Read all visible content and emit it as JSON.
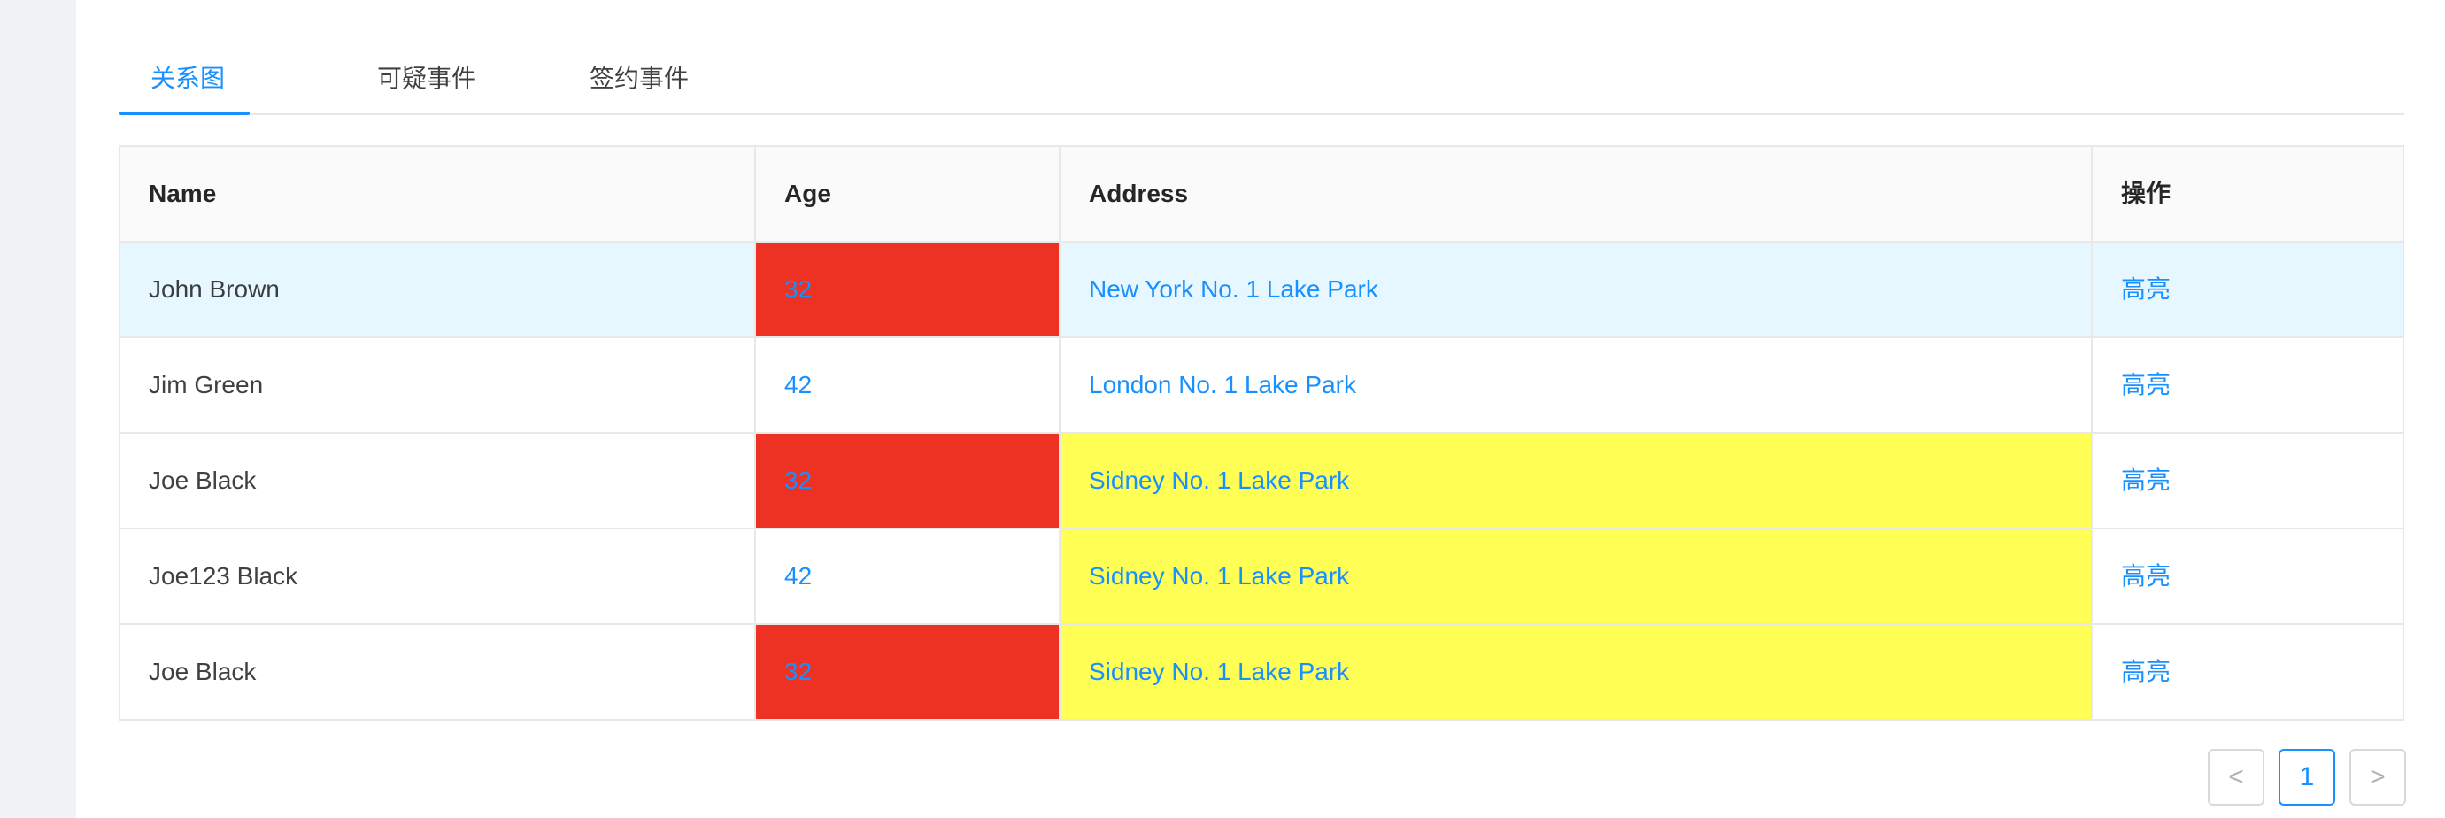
{
  "tabs": [
    {
      "label": "关系图",
      "active": true
    },
    {
      "label": "可疑事件",
      "active": false
    },
    {
      "label": "签约事件",
      "active": false
    }
  ],
  "table": {
    "columns": [
      "Name",
      "Age",
      "Address",
      "操作"
    ],
    "rows": [
      {
        "name": "John Brown",
        "age": "32",
        "address": "New York No. 1 Lake Park",
        "action": "高亮",
        "age_bg": "#ed3123",
        "address_bg": null,
        "selected": true
      },
      {
        "name": "Jim Green",
        "age": "42",
        "address": "London No. 1 Lake Park",
        "action": "高亮",
        "age_bg": null,
        "address_bg": null,
        "selected": false
      },
      {
        "name": "Joe Black",
        "age": "32",
        "address": "Sidney No. 1 Lake Park",
        "action": "高亮",
        "age_bg": "#ed3123",
        "address_bg": "#ffff55",
        "selected": false
      },
      {
        "name": "Joe123 Black",
        "age": "42",
        "address": "Sidney No. 1 Lake Park",
        "action": "高亮",
        "age_bg": null,
        "address_bg": "#ffff55",
        "selected": false
      },
      {
        "name": "Joe Black",
        "age": "32",
        "address": "Sidney No. 1 Lake Park",
        "action": "高亮",
        "age_bg": "#ed3123",
        "address_bg": "#ffff55",
        "selected": false
      }
    ]
  },
  "pagination": {
    "prev_icon": "chevron-left-icon",
    "prev_glyph": "<",
    "current_page": "1",
    "next_icon": "chevron-right-icon",
    "next_glyph": ">"
  },
  "colors": {
    "accent": "#1890ff",
    "highlight_red": "#ed3123",
    "highlight_yellow": "#ffff55",
    "selected_row": "#e6f7ff"
  }
}
